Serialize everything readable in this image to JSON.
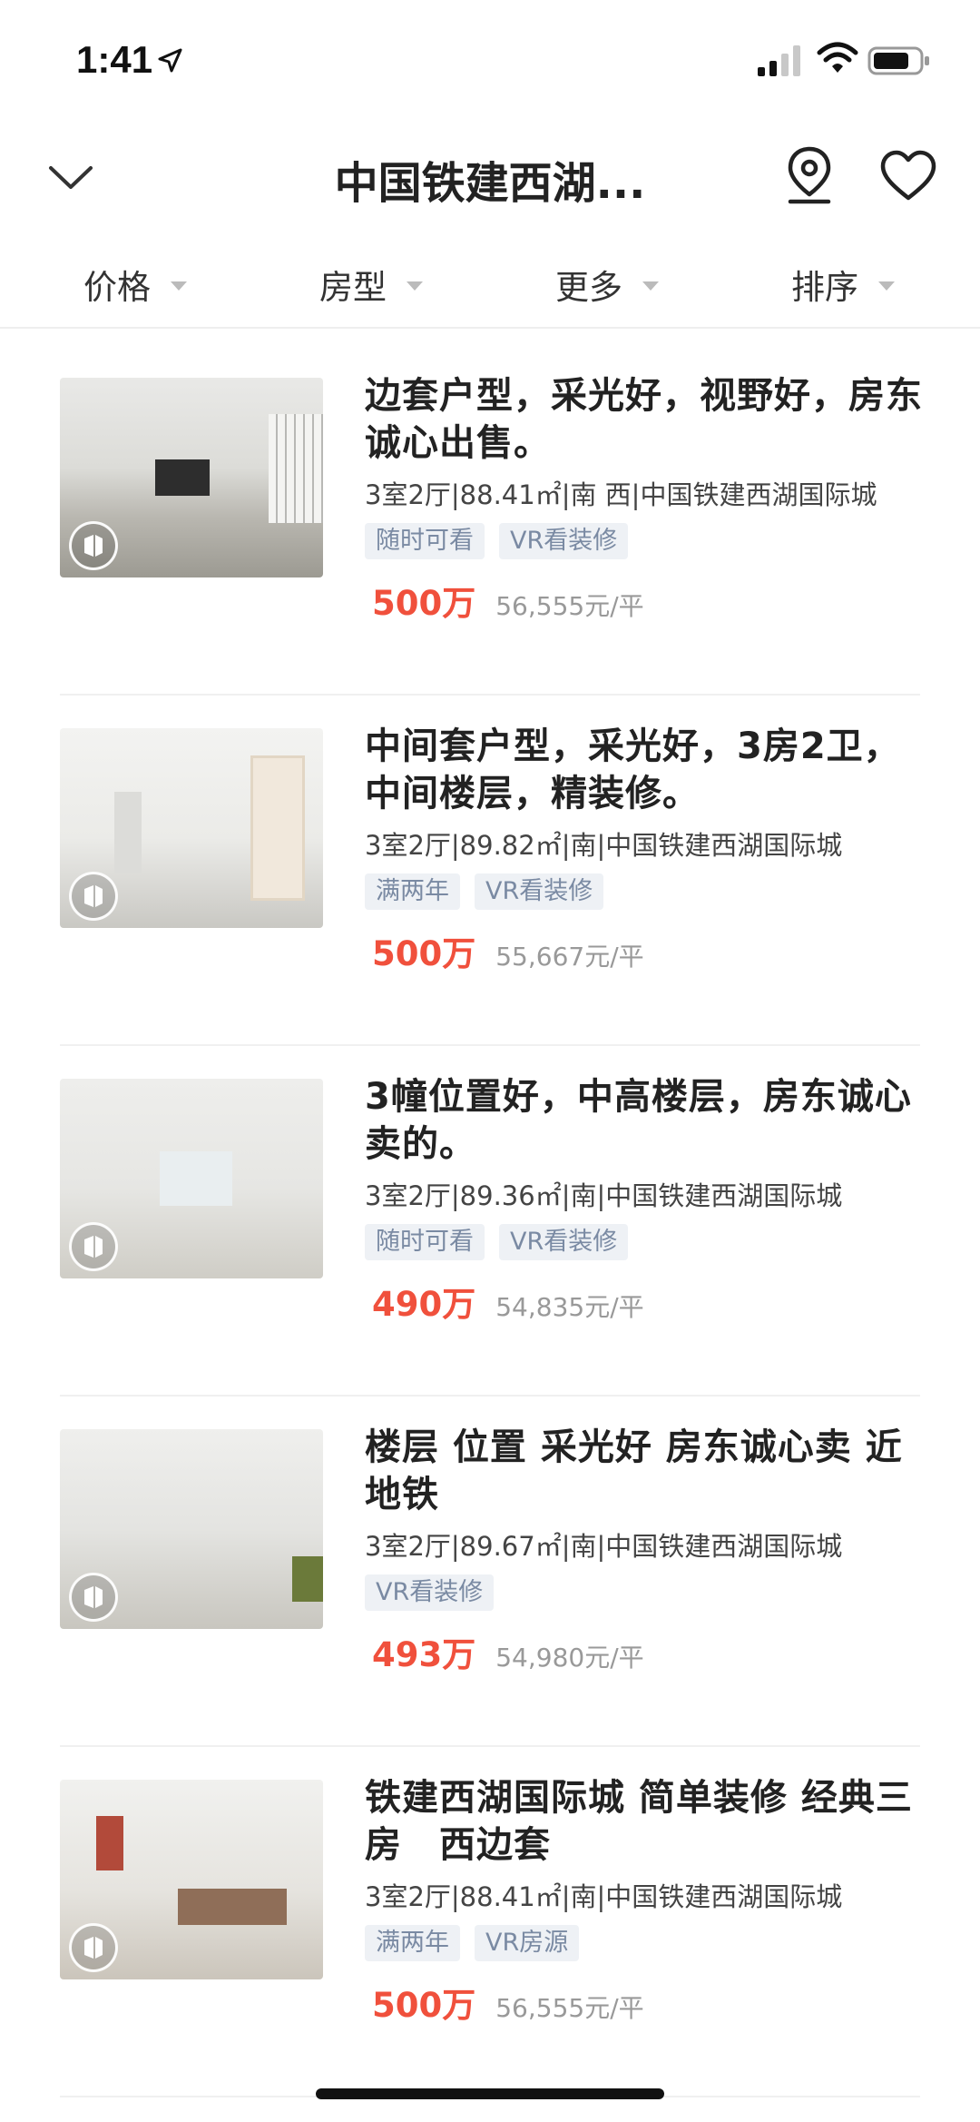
{
  "status": {
    "time": "1:41"
  },
  "header": {
    "title": "中国铁建西湖..."
  },
  "filters": [
    "价格",
    "房型",
    "更多",
    "排序"
  ],
  "listings": [
    {
      "title": "边套户型，采光好，视野好，房东诚心出售。",
      "meta": "3室2厅|88.41㎡|南 西|中国铁建西湖国际城",
      "tags": [
        "随时可看",
        "VR看装修"
      ],
      "price": "500万",
      "unit_price": "56,555元/平"
    },
    {
      "title": "中间套户型，采光好，3房2卫，中间楼层，精装修。",
      "meta": "3室2厅|89.82㎡|南|中国铁建西湖国际城",
      "tags": [
        "满两年",
        "VR看装修"
      ],
      "price": "500万",
      "unit_price": "55,667元/平"
    },
    {
      "title": "3幢位置好，中高楼层，房东诚心卖的。",
      "meta": "3室2厅|89.36㎡|南|中国铁建西湖国际城",
      "tags": [
        "随时可看",
        "VR看装修"
      ],
      "price": "490万",
      "unit_price": "54,835元/平"
    },
    {
      "title": "楼层 位置 采光好 房东诚心卖 近地铁",
      "meta": "3室2厅|89.67㎡|南|中国铁建西湖国际城",
      "tags": [
        "VR看装修"
      ],
      "price": "493万",
      "unit_price": "54,980元/平"
    },
    {
      "title": "铁建西湖国际城 简单装修 经典三房　西边套",
      "meta": "3室2厅|88.41㎡|南|中国铁建西湖国际城",
      "tags": [
        "满两年",
        "VR房源"
      ],
      "price": "500万",
      "unit_price": "56,555元/平"
    }
  ],
  "colors": {
    "price": "#f0503c",
    "tag_text": "#7a8aa3",
    "tag_bg": "#eef1f5"
  }
}
